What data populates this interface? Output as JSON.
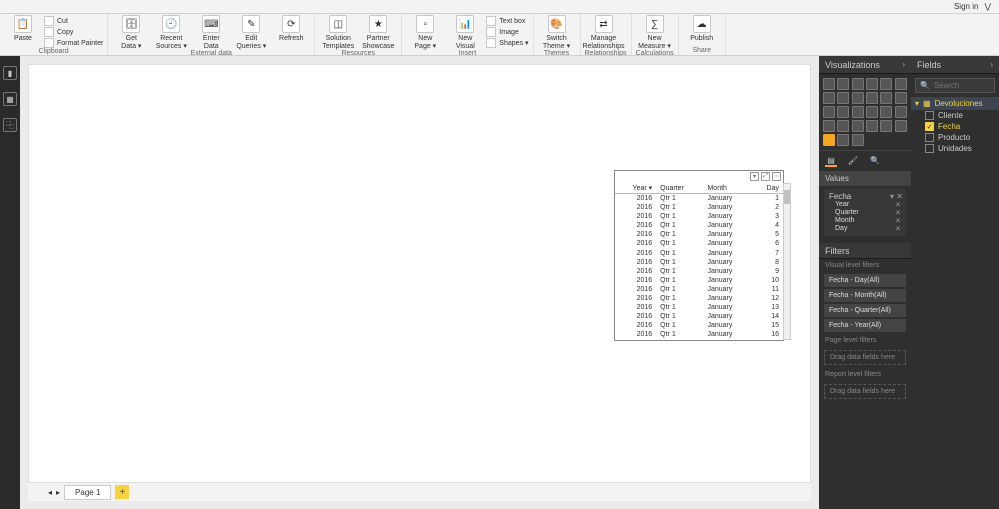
{
  "menubar": {
    "right_user": "Sign in",
    "right_gear": "⚙"
  },
  "ribbon": {
    "groups": {
      "clipboard": {
        "label": "Clipboard",
        "paste": "Paste",
        "cut": "Cut",
        "copy": "Copy",
        "fp": "Format Painter"
      },
      "external": {
        "label": "External data",
        "get": "Get\nData ▾",
        "recent": "Recent\nSources ▾",
        "enter": "Enter\nData",
        "edit": "Edit\nQueries ▾",
        "refresh": "Refresh"
      },
      "resources": {
        "label": "Resources",
        "solution": "Solution\nTemplates",
        "partner": "Partner\nShowcase"
      },
      "insert": {
        "label": "Insert",
        "newpage": "New\nPage ▾",
        "newvisual": "New\nVisual",
        "textbox": "Text box",
        "image": "Image",
        "shapes": "Shapes ▾"
      },
      "themes": {
        "label": "Themes",
        "switch": "Switch\nTheme ▾"
      },
      "relationships": {
        "label": "Relationships",
        "manage": "Manage\nRelationships"
      },
      "calculations": {
        "label": "Calculations",
        "newmeasure": "New\nMeasure ▾"
      },
      "share": {
        "label": "Share",
        "publish": "Publish"
      }
    }
  },
  "tabs": {
    "page1": "Page 1",
    "add": "+"
  },
  "table": {
    "headers": {
      "year": "Year",
      "quarter": "Quarter",
      "month": "Month",
      "day": "Day"
    },
    "rows": [
      {
        "y": "2016",
        "q": "Qtr 1",
        "m": "January",
        "d": "1"
      },
      {
        "y": "2016",
        "q": "Qtr 1",
        "m": "January",
        "d": "2"
      },
      {
        "y": "2016",
        "q": "Qtr 1",
        "m": "January",
        "d": "3"
      },
      {
        "y": "2016",
        "q": "Qtr 1",
        "m": "January",
        "d": "4"
      },
      {
        "y": "2016",
        "q": "Qtr 1",
        "m": "January",
        "d": "5"
      },
      {
        "y": "2016",
        "q": "Qtr 1",
        "m": "January",
        "d": "6"
      },
      {
        "y": "2016",
        "q": "Qtr 1",
        "m": "January",
        "d": "7"
      },
      {
        "y": "2016",
        "q": "Qtr 1",
        "m": "January",
        "d": "8"
      },
      {
        "y": "2016",
        "q": "Qtr 1",
        "m": "January",
        "d": "9"
      },
      {
        "y": "2016",
        "q": "Qtr 1",
        "m": "January",
        "d": "10"
      },
      {
        "y": "2016",
        "q": "Qtr 1",
        "m": "January",
        "d": "11"
      },
      {
        "y": "2016",
        "q": "Qtr 1",
        "m": "January",
        "d": "12"
      },
      {
        "y": "2016",
        "q": "Qtr 1",
        "m": "January",
        "d": "13"
      },
      {
        "y": "2016",
        "q": "Qtr 1",
        "m": "January",
        "d": "14"
      },
      {
        "y": "2016",
        "q": "Qtr 1",
        "m": "January",
        "d": "15"
      },
      {
        "y": "2016",
        "q": "Qtr 1",
        "m": "January",
        "d": "16"
      }
    ]
  },
  "viz": {
    "title": "Visualizations",
    "values_h": "Values",
    "well_title": "Fecha",
    "well_items": [
      "Year",
      "Quarter",
      "Month",
      "Day"
    ],
    "filters_title": "Filters",
    "visual_level": "Visual level filters",
    "filters": [
      "Fecha - Day(All)",
      "Fecha - Month(All)",
      "Fecha - Quarter(All)",
      "Fecha - Year(All)"
    ],
    "page_level": "Page level filters",
    "page_drag": "Drag data fields here",
    "report_level": "Report level filters",
    "report_drag": "Drag data fields here"
  },
  "fields": {
    "title": "Fields",
    "search_ph": "Search",
    "table_name": "Devoluciones",
    "items": [
      {
        "name": "Cliente",
        "on": false
      },
      {
        "name": "Fecha",
        "on": true
      },
      {
        "name": "Producto",
        "on": false
      },
      {
        "name": "Unidades",
        "on": false
      }
    ]
  }
}
